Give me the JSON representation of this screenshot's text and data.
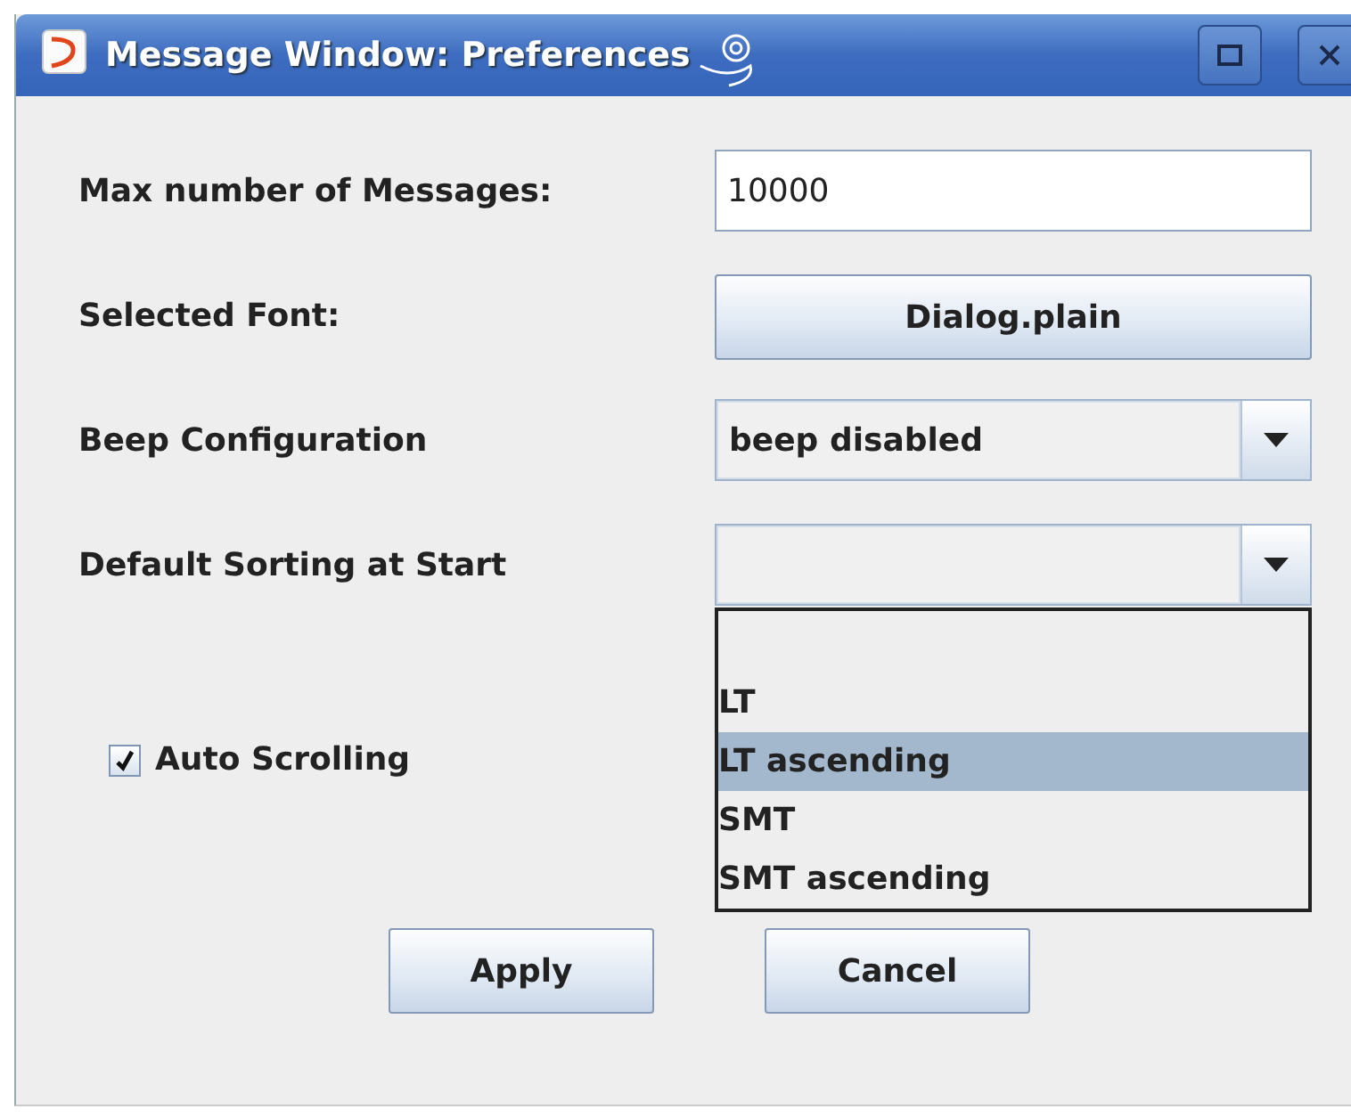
{
  "window": {
    "title": "Message Window: Preferences"
  },
  "fields": [
    {
      "kind": "text",
      "label": "Max number of Messages:",
      "value": "10000"
    },
    {
      "kind": "button",
      "label": "Selected Font:",
      "value": "Dialog.plain"
    },
    {
      "kind": "combo",
      "label": "Beep Configuration",
      "value": "beep disabled"
    },
    {
      "kind": "combo",
      "label": "Default Sorting at Start",
      "expanded": true,
      "options": [
        {
          "label": "LT",
          "selected": false
        },
        {
          "label": "LT ascending",
          "selected": true
        },
        {
          "label": "SMT",
          "selected": false
        },
        {
          "label": "SMT ascending",
          "selected": false
        }
      ]
    }
  ],
  "auto_scrolling": {
    "label": "Auto Scrolling",
    "checked": true
  },
  "buttons": [
    "Apply",
    "Cancel"
  ]
}
